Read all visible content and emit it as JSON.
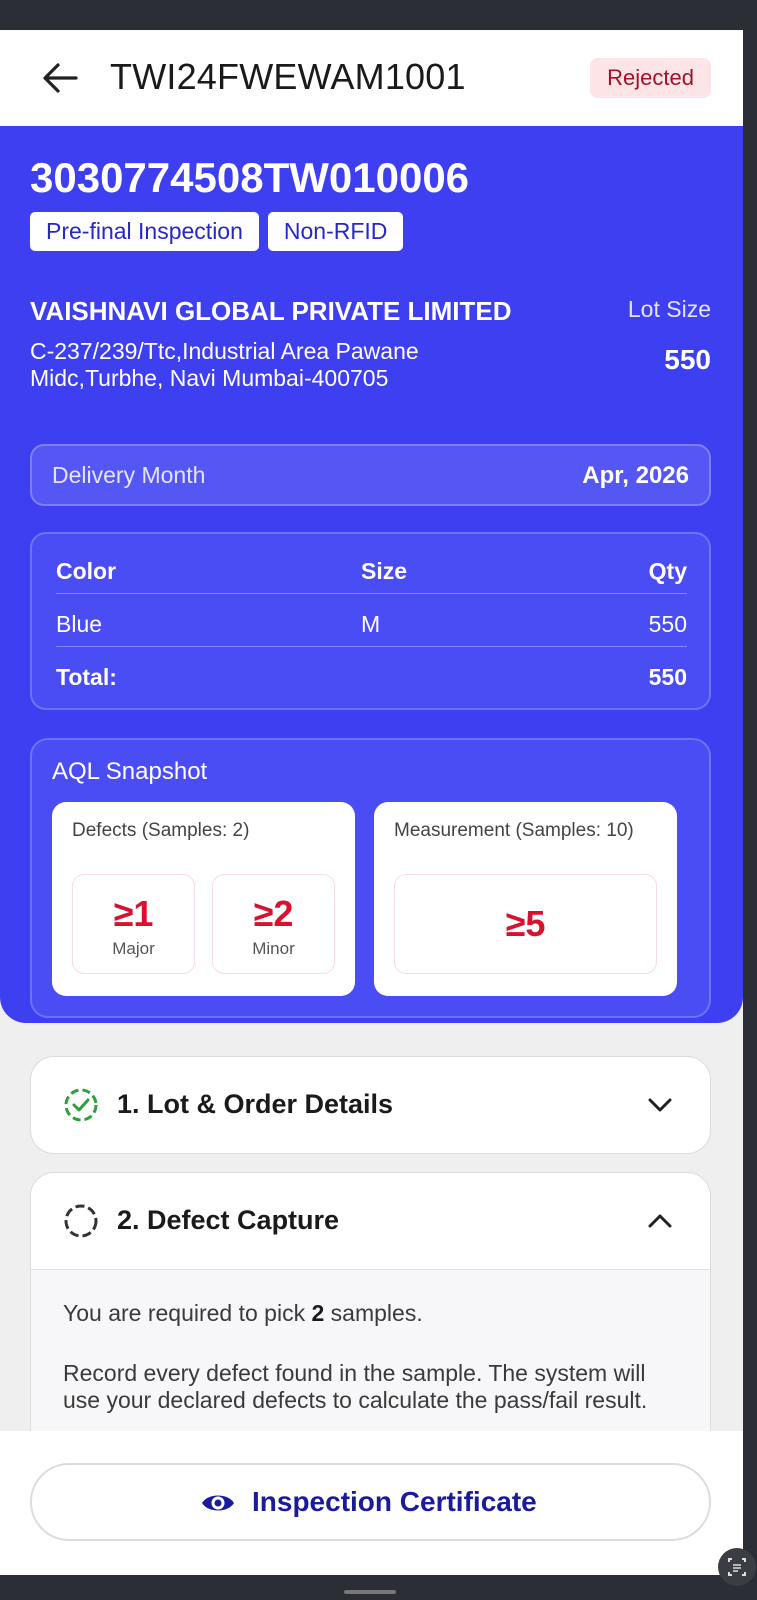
{
  "header": {
    "title": "TWI24FWEWAM1001",
    "status": "Rejected"
  },
  "summary": {
    "po_number": "3030774508TW010006",
    "tags": [
      "Pre-final Inspection",
      "Non-RFID"
    ],
    "company_name": "VAISHNAVI GLOBAL PRIVATE LIMITED",
    "address": "C-237/239/Ttc,Industrial Area Pawane Midc,Turbhe, Navi Mumbai-400705",
    "lot_size_label": "Lot Size",
    "lot_size_value": "550",
    "delivery_label": "Delivery Month",
    "delivery_value": "Apr, 2026"
  },
  "breakdown": {
    "headers": [
      "Color",
      "Size",
      "Qty"
    ],
    "rows": [
      {
        "color": "Blue",
        "size": "M",
        "qty": "550"
      }
    ],
    "total_label": "Total:",
    "total_value": "550"
  },
  "aql": {
    "title": "AQL Snapshot",
    "defects_title": "Defects (Samples: 2)",
    "major_value": "≥1",
    "major_label": "Major",
    "minor_value": "≥2",
    "minor_label": "Minor",
    "measurement_title": "Measurement (Samples: 10)",
    "measurement_value": "≥5"
  },
  "sections": {
    "lot_order": {
      "label": "1. Lot & Order Details",
      "status": "complete"
    },
    "defect_capture": {
      "label": "2. Defect Capture",
      "status": "in-progress",
      "instruction_prefix": "You are required to pick ",
      "instruction_count": "2",
      "instruction_suffix": " samples.",
      "description": "Record every defect found in the sample. The system will use your declared defects to calculate the pass/fail result."
    }
  },
  "footer": {
    "button_label": "Inspection Certificate"
  },
  "colors": {
    "primary_blue": "#3d3ff0",
    "reject_red": "#d8122e",
    "success_green": "#2e9e3e"
  }
}
